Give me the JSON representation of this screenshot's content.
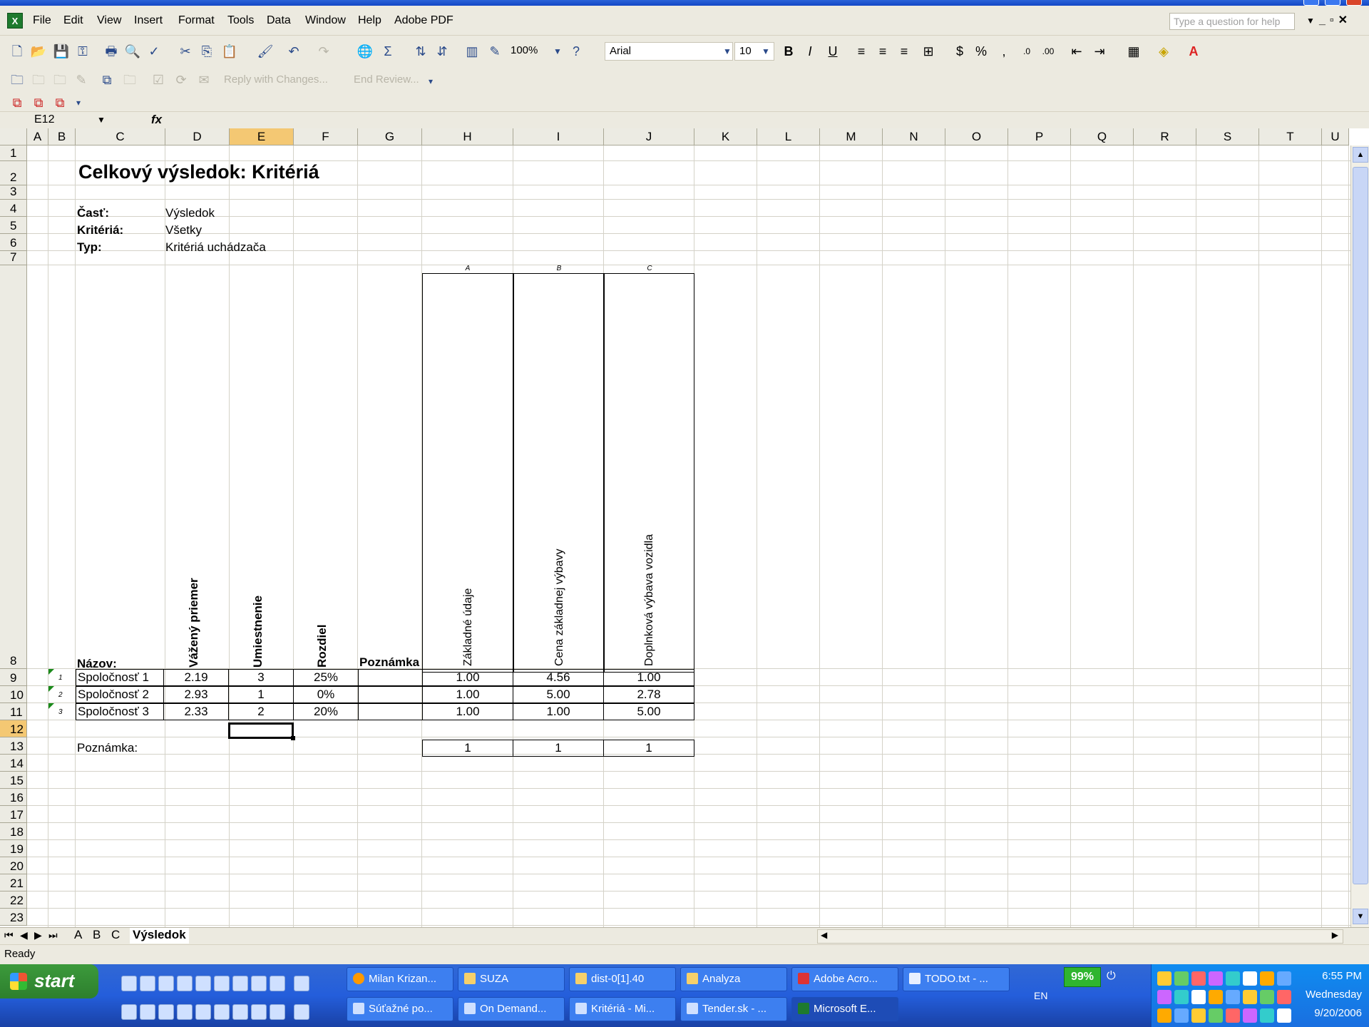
{
  "menubar": {
    "items": [
      "File",
      "Edit",
      "View",
      "Insert",
      "Format",
      "Tools",
      "Data",
      "Window",
      "Help",
      "Adobe PDF"
    ],
    "help_placeholder": "Type a question for help"
  },
  "toolbar": {
    "zoom": "100%",
    "font_name": "Arial",
    "font_size": "10",
    "reply_label": "Reply with Changes...",
    "end_review_label": "End Review..."
  },
  "formula_bar": {
    "name_box": "E12",
    "fx": "fx",
    "formula": ""
  },
  "columns": [
    "A",
    "B",
    "C",
    "D",
    "E",
    "F",
    "G",
    "H",
    "I",
    "J",
    "K",
    "L",
    "M",
    "N",
    "O",
    "P",
    "Q",
    "R",
    "S",
    "T",
    "U"
  ],
  "rows": [
    "1",
    "2",
    "3",
    "4",
    "5",
    "6",
    "7",
    "8",
    "9",
    "10",
    "11",
    "12",
    "13",
    "14",
    "15",
    "16",
    "17",
    "18",
    "19",
    "20",
    "21",
    "22",
    "23"
  ],
  "sheet": {
    "title": "Celkový výsledok: Kritériá",
    "meta": [
      {
        "label": "Časť:",
        "value": "Výsledok"
      },
      {
        "label": "Kritériá:",
        "value": "Všetky"
      },
      {
        "label": "Typ:",
        "value": "Kritériá uchádzača"
      }
    ],
    "group_letters": [
      "A",
      "B",
      "C"
    ],
    "headers": {
      "name": "Názov:",
      "weighted_avg": "Vážený priemer",
      "rank": "Umiestnenie",
      "difference": "Rozdiel",
      "note": "Poznámka",
      "criteria": [
        "Základné údaje",
        "Cena základnej výbavy",
        "Doplnková výbava vozidla"
      ]
    },
    "rows": [
      {
        "num": "1",
        "name": "Spoločnosť 1",
        "weighted_avg": "2.19",
        "rank": "3",
        "difference": "25%",
        "scores": [
          "1.00",
          "4.56",
          "1.00"
        ]
      },
      {
        "num": "2",
        "name": "Spoločnosť 2",
        "weighted_avg": "2.93",
        "rank": "1",
        "difference": "0%",
        "scores": [
          "1.00",
          "5.00",
          "2.78"
        ]
      },
      {
        "num": "3",
        "name": "Spoločnosť 3",
        "weighted_avg": "2.33",
        "rank": "2",
        "difference": "20%",
        "scores": [
          "1.00",
          "1.00",
          "5.00"
        ]
      }
    ],
    "footer_label": "Poznámka:",
    "footer_values": [
      "1",
      "1",
      "1"
    ]
  },
  "sheet_tabs": [
    "A",
    "B",
    "C",
    "Výsledok"
  ],
  "active_tab": "Výsledok",
  "status": "Ready",
  "taskbar": {
    "start_label": "start",
    "top_buttons": [
      "Milan Krizan...",
      "SUZA",
      "dist-0[1].40",
      "Analyza",
      "Adobe Acro...",
      "TODO.txt - ..."
    ],
    "bottom_buttons": [
      "Súťažné po...",
      "On Demand...",
      "Kritériá - Mi...",
      "Tender.sk - ...",
      "Microsoft E..."
    ],
    "language": "EN",
    "battery": "99%",
    "time": "6:55 PM",
    "day": "Wednesday",
    "date": "9/20/2006"
  },
  "colors": {
    "active_header": "#f4c873",
    "taskbar": "#245edb",
    "start_green": "#2d7f2d",
    "tray": "#0f8cf0"
  }
}
